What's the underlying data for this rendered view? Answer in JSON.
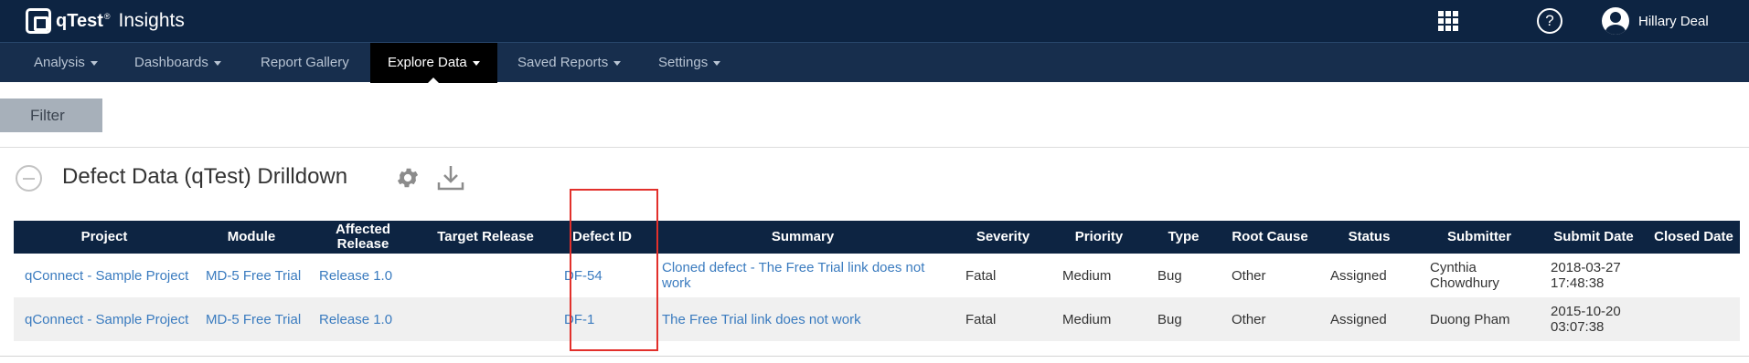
{
  "header": {
    "brand": "qTest",
    "brand_tm": "®",
    "product": "Insights",
    "user_name": "Hillary Deal",
    "help_glyph": "?",
    "icons": [
      "apps-grid-icon",
      "help-icon",
      "user-avatar-icon"
    ]
  },
  "nav": {
    "items": [
      {
        "label": "Analysis",
        "dropdown": true,
        "active": false
      },
      {
        "label": "Dashboards",
        "dropdown": true,
        "active": false
      },
      {
        "label": "Report Gallery",
        "dropdown": false,
        "active": false
      },
      {
        "label": "Explore Data",
        "dropdown": true,
        "active": true
      },
      {
        "label": "Saved Reports",
        "dropdown": true,
        "active": false
      },
      {
        "label": "Settings",
        "dropdown": true,
        "active": false
      }
    ]
  },
  "filter": {
    "label": "Filter"
  },
  "section": {
    "title": "Defect Data (qTest) Drilldown",
    "icons": [
      "collapse-icon",
      "gear-icon",
      "download-icon"
    ]
  },
  "table": {
    "columns": [
      "Project",
      "Module",
      "Affected Release",
      "Target Release",
      "Defect ID",
      "Summary",
      "Severity",
      "Priority",
      "Type",
      "Root Cause",
      "Status",
      "Submitter",
      "Submit Date",
      "Closed Date"
    ],
    "rows": [
      {
        "project": "qConnect - Sample Project",
        "module": "MD-5 Free Trial",
        "affected_release": "Release 1.0",
        "target_release": "",
        "defect_id": "DF-54",
        "summary": "Cloned defect - The Free Trial link does not work",
        "severity": "Fatal",
        "priority": "Medium",
        "type": "Bug",
        "root_cause": "Other",
        "status": "Assigned",
        "submitter": "Cynthia Chowdhury",
        "submit_date": "2018-03-27 17:48:38",
        "closed_date": ""
      },
      {
        "project": "qConnect - Sample Project",
        "module": "MD-5 Free Trial",
        "affected_release": "Release 1.0",
        "target_release": "",
        "defect_id": "DF-1",
        "summary": "The Free Trial link does not work",
        "severity": "Fatal",
        "priority": "Medium",
        "type": "Bug",
        "root_cause": "Other",
        "status": "Assigned",
        "submitter": "Duong Pham",
        "submit_date": "2015-10-20 03:07:38",
        "closed_date": ""
      }
    ]
  },
  "colors": {
    "header_bg": "#0d2442",
    "nav_bg": "#172e4d",
    "active_nav_bg": "#000000",
    "link": "#3a7bbf",
    "highlight": "#e2302b",
    "filter_bg": "#a7b0ba"
  }
}
